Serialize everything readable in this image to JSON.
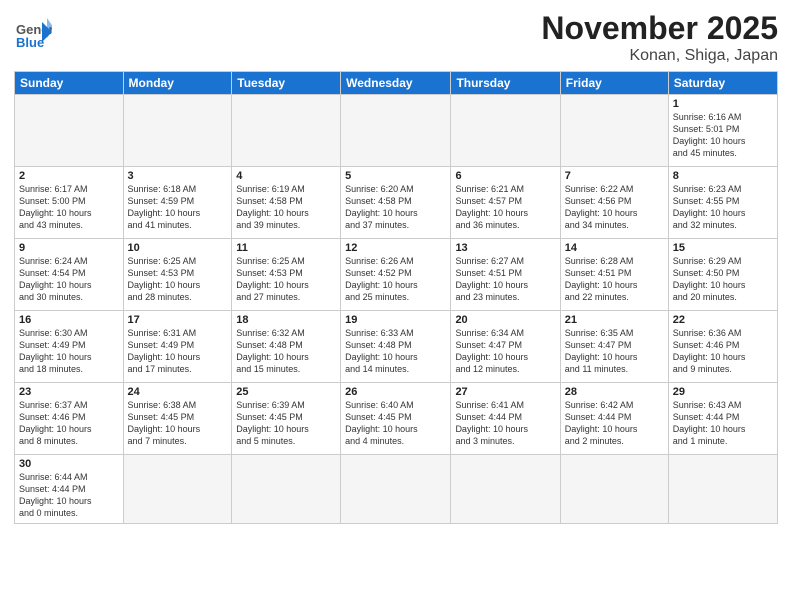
{
  "header": {
    "logo_general": "General",
    "logo_blue": "Blue",
    "month": "November 2025",
    "location": "Konan, Shiga, Japan"
  },
  "weekdays": [
    "Sunday",
    "Monday",
    "Tuesday",
    "Wednesday",
    "Thursday",
    "Friday",
    "Saturday"
  ],
  "weeks": [
    [
      {
        "day": "",
        "info": ""
      },
      {
        "day": "",
        "info": ""
      },
      {
        "day": "",
        "info": ""
      },
      {
        "day": "",
        "info": ""
      },
      {
        "day": "",
        "info": ""
      },
      {
        "day": "",
        "info": ""
      },
      {
        "day": "1",
        "info": "Sunrise: 6:16 AM\nSunset: 5:01 PM\nDaylight: 10 hours\nand 45 minutes."
      }
    ],
    [
      {
        "day": "2",
        "info": "Sunrise: 6:17 AM\nSunset: 5:00 PM\nDaylight: 10 hours\nand 43 minutes."
      },
      {
        "day": "3",
        "info": "Sunrise: 6:18 AM\nSunset: 4:59 PM\nDaylight: 10 hours\nand 41 minutes."
      },
      {
        "day": "4",
        "info": "Sunrise: 6:19 AM\nSunset: 4:58 PM\nDaylight: 10 hours\nand 39 minutes."
      },
      {
        "day": "5",
        "info": "Sunrise: 6:20 AM\nSunset: 4:58 PM\nDaylight: 10 hours\nand 37 minutes."
      },
      {
        "day": "6",
        "info": "Sunrise: 6:21 AM\nSunset: 4:57 PM\nDaylight: 10 hours\nand 36 minutes."
      },
      {
        "day": "7",
        "info": "Sunrise: 6:22 AM\nSunset: 4:56 PM\nDaylight: 10 hours\nand 34 minutes."
      },
      {
        "day": "8",
        "info": "Sunrise: 6:23 AM\nSunset: 4:55 PM\nDaylight: 10 hours\nand 32 minutes."
      }
    ],
    [
      {
        "day": "9",
        "info": "Sunrise: 6:24 AM\nSunset: 4:54 PM\nDaylight: 10 hours\nand 30 minutes."
      },
      {
        "day": "10",
        "info": "Sunrise: 6:25 AM\nSunset: 4:53 PM\nDaylight: 10 hours\nand 28 minutes."
      },
      {
        "day": "11",
        "info": "Sunrise: 6:25 AM\nSunset: 4:53 PM\nDaylight: 10 hours\nand 27 minutes."
      },
      {
        "day": "12",
        "info": "Sunrise: 6:26 AM\nSunset: 4:52 PM\nDaylight: 10 hours\nand 25 minutes."
      },
      {
        "day": "13",
        "info": "Sunrise: 6:27 AM\nSunset: 4:51 PM\nDaylight: 10 hours\nand 23 minutes."
      },
      {
        "day": "14",
        "info": "Sunrise: 6:28 AM\nSunset: 4:51 PM\nDaylight: 10 hours\nand 22 minutes."
      },
      {
        "day": "15",
        "info": "Sunrise: 6:29 AM\nSunset: 4:50 PM\nDaylight: 10 hours\nand 20 minutes."
      }
    ],
    [
      {
        "day": "16",
        "info": "Sunrise: 6:30 AM\nSunset: 4:49 PM\nDaylight: 10 hours\nand 18 minutes."
      },
      {
        "day": "17",
        "info": "Sunrise: 6:31 AM\nSunset: 4:49 PM\nDaylight: 10 hours\nand 17 minutes."
      },
      {
        "day": "18",
        "info": "Sunrise: 6:32 AM\nSunset: 4:48 PM\nDaylight: 10 hours\nand 15 minutes."
      },
      {
        "day": "19",
        "info": "Sunrise: 6:33 AM\nSunset: 4:48 PM\nDaylight: 10 hours\nand 14 minutes."
      },
      {
        "day": "20",
        "info": "Sunrise: 6:34 AM\nSunset: 4:47 PM\nDaylight: 10 hours\nand 12 minutes."
      },
      {
        "day": "21",
        "info": "Sunrise: 6:35 AM\nSunset: 4:47 PM\nDaylight: 10 hours\nand 11 minutes."
      },
      {
        "day": "22",
        "info": "Sunrise: 6:36 AM\nSunset: 4:46 PM\nDaylight: 10 hours\nand 9 minutes."
      }
    ],
    [
      {
        "day": "23",
        "info": "Sunrise: 6:37 AM\nSunset: 4:46 PM\nDaylight: 10 hours\nand 8 minutes."
      },
      {
        "day": "24",
        "info": "Sunrise: 6:38 AM\nSunset: 4:45 PM\nDaylight: 10 hours\nand 7 minutes."
      },
      {
        "day": "25",
        "info": "Sunrise: 6:39 AM\nSunset: 4:45 PM\nDaylight: 10 hours\nand 5 minutes."
      },
      {
        "day": "26",
        "info": "Sunrise: 6:40 AM\nSunset: 4:45 PM\nDaylight: 10 hours\nand 4 minutes."
      },
      {
        "day": "27",
        "info": "Sunrise: 6:41 AM\nSunset: 4:44 PM\nDaylight: 10 hours\nand 3 minutes."
      },
      {
        "day": "28",
        "info": "Sunrise: 6:42 AM\nSunset: 4:44 PM\nDaylight: 10 hours\nand 2 minutes."
      },
      {
        "day": "29",
        "info": "Sunrise: 6:43 AM\nSunset: 4:44 PM\nDaylight: 10 hours\nand 1 minute."
      }
    ],
    [
      {
        "day": "30",
        "info": "Sunrise: 6:44 AM\nSunset: 4:44 PM\nDaylight: 10 hours\nand 0 minutes."
      },
      {
        "day": "",
        "info": ""
      },
      {
        "day": "",
        "info": ""
      },
      {
        "day": "",
        "info": ""
      },
      {
        "day": "",
        "info": ""
      },
      {
        "day": "",
        "info": ""
      },
      {
        "day": "",
        "info": ""
      }
    ]
  ]
}
